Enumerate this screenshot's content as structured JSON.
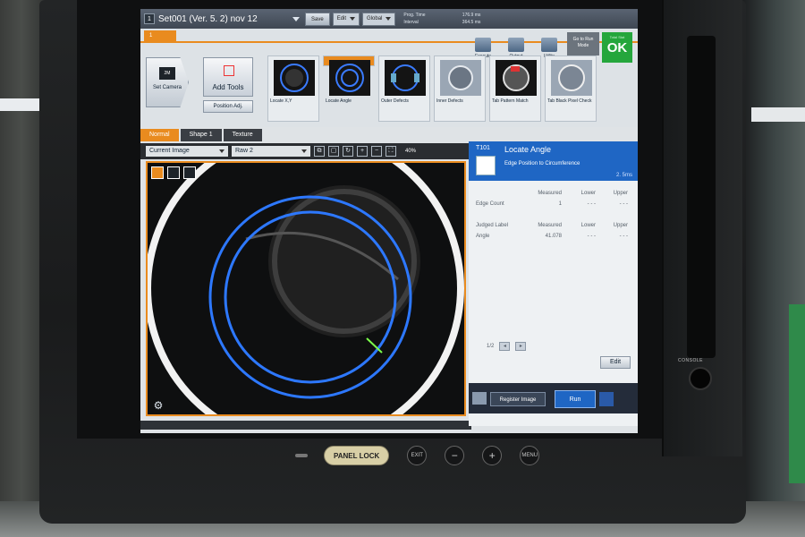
{
  "header": {
    "set_number": "1",
    "set_name": "Set001 (Ver. 5. 2) nov 12",
    "save_label": "Save",
    "edit_label": "Edit",
    "global_label": "Global",
    "prog_label": "Prog. Time",
    "prog_value": "176.9 ms",
    "interval_label": "Interval",
    "interval_value": "364.5 ms"
  },
  "actions": {
    "execute": "Execute",
    "output": "Output",
    "utility": "Utility",
    "run_mode": "Go to Run Mode",
    "total_status_label": "Total Stat",
    "total_status_value": "OK"
  },
  "toolbar": {
    "tab_label": "1",
    "set_camera": "Set Camera",
    "camera_badge": "2M",
    "add_tools": "Add Tools",
    "position_adj": "Position Adj.",
    "tools": [
      {
        "label": "Locate X,Y"
      },
      {
        "label": "Locate Angle"
      },
      {
        "label": "Outer Defects"
      },
      {
        "label": "Inner Defects"
      },
      {
        "label": "Tab Pattern Match"
      },
      {
        "label": "Tab Black Pixel Check"
      }
    ]
  },
  "view": {
    "tabs": [
      "Normal",
      "Shape 1",
      "Texture"
    ],
    "image_select": "Current Image",
    "raw_select": "Raw 2",
    "zoom": "40%"
  },
  "detail": {
    "id": "T101",
    "name": "Locate Angle",
    "subtitle": "Edge Position to Circumference",
    "time": "2. 5ms",
    "head1": [
      "",
      "Measured",
      "Lower",
      "Upper"
    ],
    "row1": [
      "Edge Count",
      "1",
      "- - -",
      "- - -"
    ],
    "head2": [
      "Judged Label",
      "Measured",
      "Lower",
      "Upper"
    ],
    "row2": [
      "Angle",
      "41.078",
      "- - -",
      "- - -"
    ],
    "page": "1/2",
    "edit": "Edit"
  },
  "bottom": {
    "register": "Register Image",
    "run": "Run"
  },
  "hardware": {
    "panel_lock": "PANEL LOCK",
    "exit": "EXIT",
    "minus": "−",
    "plus": "+",
    "menu": "MENU",
    "console": "CONSOLE"
  }
}
